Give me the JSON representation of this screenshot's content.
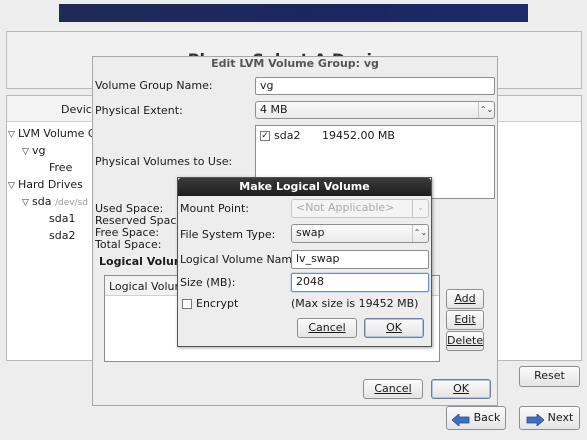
{
  "background_page": {
    "title": "Please Select A Device",
    "device_column": "Device",
    "tree": {
      "lvm_group": "LVM Volume G",
      "vg": "vg",
      "free": "Free",
      "hard_drives": "Hard Drives",
      "sda": "sda",
      "sda_path": "/dev/sd",
      "sda1": "sda1",
      "sda2": "sda2"
    },
    "reset_label": "Reset",
    "back_label": "Back",
    "next_label": "Next"
  },
  "edit_dialog": {
    "title": "Edit LVM Volume Group: vg",
    "vg_name_label": "Volume Group Name:",
    "vg_name_value": "vg",
    "extent_label": "Physical Extent:",
    "extent_value": "4 MB",
    "pv_label": "Physical Volumes to Use:",
    "pv_items": [
      {
        "checked": true,
        "name": "sda2",
        "size": "19452.00 MB"
      }
    ],
    "used_space_label": "Used Space:",
    "reserved_space_label": "Reserved Space:",
    "free_space_label": "Free Space:",
    "total_space_label": "Total Space:",
    "logical_volumes_heading": "Logical Volume",
    "lv_column_header": "Logical Volume",
    "add_label": "Add",
    "edit_label": "Edit",
    "delete_label": "Delete",
    "cancel_label": "Cancel",
    "ok_label": "OK"
  },
  "make_lv_dialog": {
    "title": "Make Logical Volume",
    "mount_point_label": "Mount Point:",
    "mount_point_value": "<Not Applicable>",
    "fs_type_label": "File System Type:",
    "fs_type_value": "swap",
    "lv_name_label": "Logical Volume Name:",
    "lv_name_value": "lv_swap",
    "size_label": "Size (MB):",
    "size_value": "2048",
    "encrypt_label": "Encrypt",
    "max_size_note": "(Max size is 19452 MB)",
    "cancel_label": "Cancel",
    "ok_label": "OK"
  }
}
